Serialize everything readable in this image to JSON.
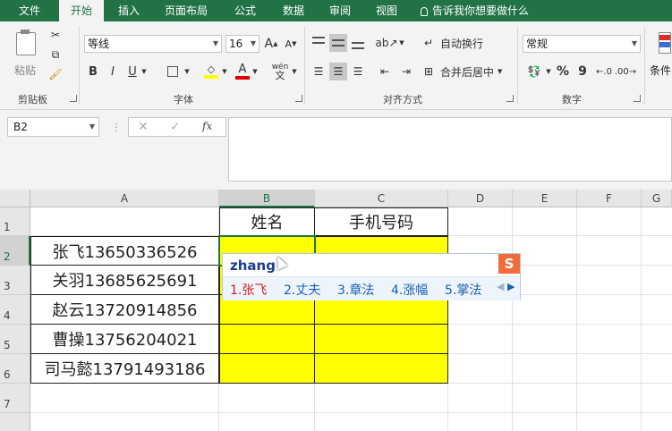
{
  "tabs": [
    "文件",
    "开始",
    "插入",
    "页面布局",
    "公式",
    "数据",
    "审阅",
    "视图"
  ],
  "tell_me": "告诉我你想要做什么",
  "ribbon": {
    "clipboard": {
      "paste": "粘贴",
      "label": "剪贴板"
    },
    "font": {
      "name": "等线",
      "size": "16",
      "label": "字体",
      "bold": "B",
      "italic": "I",
      "underline": "U",
      "phonetic": "wén",
      "phonetic_char": "文",
      "grow": "A",
      "shrink": "A"
    },
    "alignment": {
      "wrap": "自动换行",
      "merge": "合并后居中",
      "label": "对齐方式"
    },
    "number": {
      "format": "常规",
      "percent": "%",
      "comma": "9",
      "label": "数字"
    },
    "styles": {
      "conditional": "条件"
    }
  },
  "formula_bar": {
    "name_box": "B2",
    "fx": "fx",
    "formula": ""
  },
  "columns": [
    "A",
    "B",
    "C",
    "D",
    "E",
    "F",
    "G"
  ],
  "rows": [
    "1",
    "2",
    "3",
    "4",
    "5",
    "6",
    "7"
  ],
  "cells": {
    "header": [
      "",
      "姓名",
      "手机号码"
    ],
    "data": [
      "张飞13650336526",
      "关羽13685625691",
      "赵云13720914856",
      "曹操13756204021",
      "司马懿13791493186"
    ]
  },
  "colors": {
    "accent": "#217346",
    "highlight": "#ffff00"
  },
  "ime": {
    "composition": "zhang",
    "candidates": [
      "1.张飞",
      "2.丈夫",
      "3.章法",
      "4.涨幅",
      "5.掌法"
    ]
  }
}
